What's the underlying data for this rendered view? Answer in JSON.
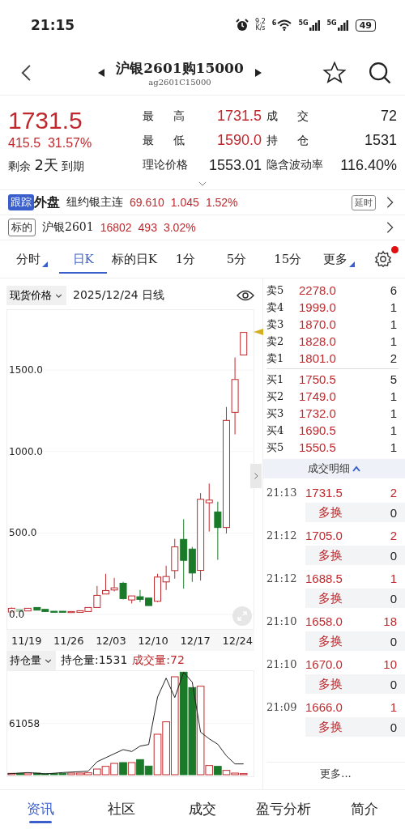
{
  "status_bar": {
    "time": "21:15",
    "speed_value": "9.2",
    "speed_unit": "K/s",
    "wifi_badge": "6",
    "sim_labels": [
      "5G",
      "5G"
    ],
    "battery": "49"
  },
  "header": {
    "title": "沪银2601购15000",
    "code": "ag2601C15000"
  },
  "quote": {
    "price": "1731.5",
    "change": "415.5",
    "change_pct": "31.57%",
    "expiry": {
      "prefix": "剩余",
      "days": "2天",
      "suffix": "到期"
    },
    "stats": [
      {
        "label": "最 高",
        "value": "1731.5",
        "up": true,
        "spread": true
      },
      {
        "label": "成 交",
        "value": "72",
        "up": false,
        "spread": true
      },
      {
        "label": "最 低",
        "value": "1590.0",
        "up": true,
        "spread": true
      },
      {
        "label": "持 仓",
        "value": "1531",
        "up": false,
        "spread": true
      },
      {
        "label": "理论价格",
        "value": "1553.01",
        "up": false,
        "spread": false
      },
      {
        "label": "隐含波动率",
        "value": "116.40%",
        "up": false,
        "spread": false
      }
    ]
  },
  "links": [
    {
      "badge": "跟踪",
      "badge_filled": true,
      "title": "外盘",
      "name": "纽约银主连",
      "values": [
        "69.610",
        "1.045",
        "1.52%"
      ],
      "tag": "延时"
    },
    {
      "badge": "标的",
      "badge_filled": false,
      "name": "沪银2601",
      "values": [
        "16802",
        "493",
        "3.02%"
      ]
    }
  ],
  "period_tabs": [
    {
      "label": "分时",
      "selected": false,
      "menu": true
    },
    {
      "label": "日K",
      "selected": true,
      "menu": false
    },
    {
      "label": "标的日K",
      "selected": false,
      "menu": false
    },
    {
      "label": "1分",
      "selected": false,
      "menu": false
    },
    {
      "label": "5分",
      "selected": false,
      "menu": false
    },
    {
      "label": "15分",
      "selected": false,
      "menu": false
    },
    {
      "label": "更多",
      "selected": false,
      "menu": true
    }
  ],
  "settings_alert": true,
  "chart": {
    "price_type": "现货价格",
    "date": "2025/12/24",
    "interval": "日线",
    "yticks": [
      "1500.0",
      "1000.0",
      "500.0",
      "0.0"
    ],
    "xticks": [
      "11/19",
      "11/26",
      "12/03",
      "12/10",
      "12/17",
      "12/24"
    ]
  },
  "volume": {
    "indicator": "持仓量",
    "open_interest": "持仓量:1531",
    "volume": "成交量:72",
    "ytick": "61058"
  },
  "order_book": {
    "asks": [
      {
        "label": "卖5",
        "price": "2278.0",
        "qty": "6"
      },
      {
        "label": "卖4",
        "price": "1999.0",
        "qty": "1"
      },
      {
        "label": "卖3",
        "price": "1870.0",
        "qty": "1"
      },
      {
        "label": "卖2",
        "price": "1828.0",
        "qty": "1"
      },
      {
        "label": "卖1",
        "price": "1801.0",
        "qty": "2"
      }
    ],
    "bids": [
      {
        "label": "买1",
        "price": "1750.5",
        "qty": "5"
      },
      {
        "label": "买2",
        "price": "1749.0",
        "qty": "1"
      },
      {
        "label": "买3",
        "price": "1732.0",
        "qty": "1"
      },
      {
        "label": "买4",
        "price": "1690.5",
        "qty": "1"
      },
      {
        "label": "买5",
        "price": "1550.5",
        "qty": "1"
      }
    ]
  },
  "trades": {
    "title": "成交明细",
    "rows": [
      {
        "time": "21:13",
        "price": "1731.5",
        "qty": "2",
        "type": "多换",
        "change": "0"
      },
      {
        "time": "21:12",
        "price": "1705.0",
        "qty": "2",
        "type": "多换",
        "change": "0"
      },
      {
        "time": "21:12",
        "price": "1688.5",
        "qty": "1",
        "type": "多换",
        "change": "0"
      },
      {
        "time": "21:10",
        "price": "1658.0",
        "qty": "18",
        "type": "多换",
        "change": "0"
      },
      {
        "time": "21:10",
        "price": "1670.0",
        "qty": "10",
        "type": "多换",
        "change": "0"
      },
      {
        "time": "21:09",
        "price": "1666.0",
        "qty": "1",
        "type": "多换",
        "change": "0"
      }
    ],
    "more": "更多..."
  },
  "nav": [
    {
      "label": "资讯",
      "selected": true
    },
    {
      "label": "社区",
      "selected": false
    },
    {
      "label": "成交",
      "selected": false
    },
    {
      "label": "盈亏分析",
      "selected": false
    },
    {
      "label": "简介",
      "selected": false
    }
  ]
}
